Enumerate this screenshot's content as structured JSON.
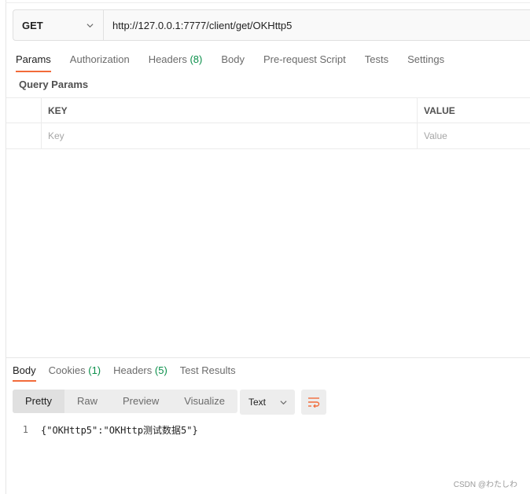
{
  "request": {
    "method": "GET",
    "url": "http://127.0.0.1:7777/client/get/OKHttp5"
  },
  "request_tabs": [
    {
      "label": "Params",
      "active": true
    },
    {
      "label": "Authorization"
    },
    {
      "label": "Headers",
      "count": "(8)"
    },
    {
      "label": "Body"
    },
    {
      "label": "Pre-request Script"
    },
    {
      "label": "Tests"
    },
    {
      "label": "Settings"
    }
  ],
  "query_params": {
    "title": "Query Params",
    "headers": {
      "key": "KEY",
      "value": "VALUE"
    },
    "row": {
      "key_placeholder": "Key",
      "value_placeholder": "Value"
    }
  },
  "response_tabs": [
    {
      "label": "Body",
      "active": true
    },
    {
      "label": "Cookies",
      "count": "(1)"
    },
    {
      "label": "Headers",
      "count": "(5)"
    },
    {
      "label": "Test Results"
    }
  ],
  "view_modes": [
    "Pretty",
    "Raw",
    "Preview",
    "Visualize"
  ],
  "format": "Text",
  "response_body": {
    "line_number": "1",
    "text": "{\"OKHttp5\":\"OKHttp测试数据5\"}"
  },
  "watermark": "CSDN @わたしわ",
  "colors": {
    "accent": "#f26b3a",
    "count": "#0a8f4a"
  }
}
